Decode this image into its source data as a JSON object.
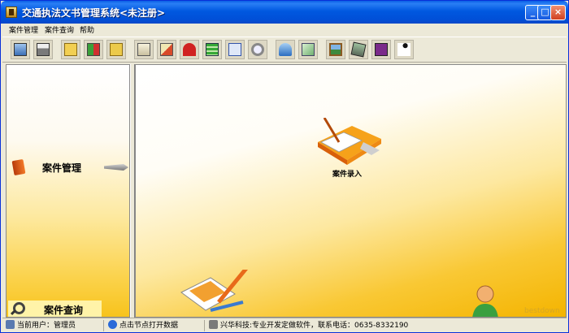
{
  "window": {
    "title": "交通执法文书管理系统<未注册>"
  },
  "title_buttons": {
    "minimize": "_",
    "maximize": "□",
    "close": "×"
  },
  "menu": {
    "items": [
      "案件管理",
      "案件查询",
      "帮助"
    ]
  },
  "toolbar": {
    "icons": [
      "monitor-icon",
      "printer-icon",
      "folder-icon",
      "copy-files-icon",
      "folder-open-icon",
      "document-scroll-icon",
      "transfer-icon",
      "umbrella-icon",
      "notebook-icon",
      "preview-icon",
      "magnifier-icon",
      "bell-icon",
      "envelope-icon",
      "picture-icon",
      "pda-icon",
      "help-book-icon",
      "running-man-icon"
    ]
  },
  "sidebar": {
    "case_management_label": "案件管理",
    "case_query_label": "案件查询"
  },
  "main": {
    "case_entry_label": "案件录入",
    "watermark": "bestdown"
  },
  "status": {
    "current_user": "当前用户：管理员",
    "hint": "点击节点打开数据",
    "company": "兴华科技:专业开发定做软件，联系电话：0635-8332190"
  },
  "colors": {
    "titlebar": "#0a5ee4",
    "panel_yellow": "#f9c834",
    "window_face": "#ece9d8"
  }
}
